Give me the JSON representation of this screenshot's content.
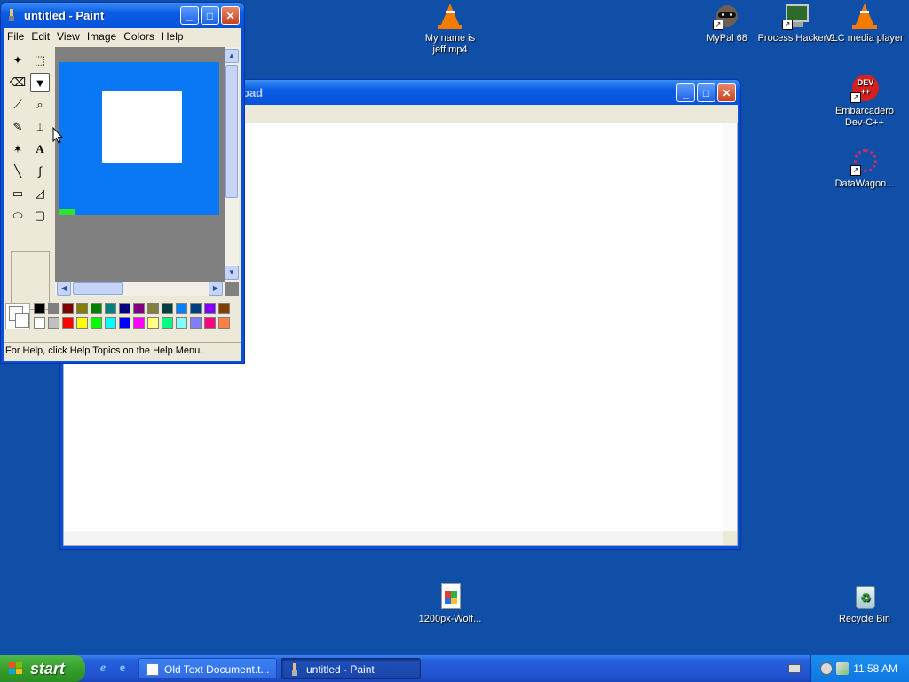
{
  "desktop": {
    "icons": [
      {
        "label": "My name is jeff.mp4",
        "icon": "vlc-cone-icon"
      },
      {
        "label": "MyPal 68",
        "icon": "raccoon-icon"
      },
      {
        "label": "Process Hacker 2",
        "icon": "monitor-icon"
      },
      {
        "label": "VLC media player",
        "icon": "vlc-cone-icon"
      },
      {
        "label": "Embarcadero Dev-C++",
        "icon": "devcpp-icon"
      },
      {
        "label": "DataWagon...",
        "icon": "network-icon"
      },
      {
        "label": "1200px-Wolf...",
        "icon": "image-file-icon"
      },
      {
        "label": "Recycle Bin",
        "icon": "recycle-bin-icon"
      }
    ],
    "shortcut_glyph": "↗"
  },
  "notepad": {
    "title_fragment": "pad",
    "buttons": {
      "minimize": "_",
      "maximize": "□",
      "close": "✕"
    }
  },
  "paint": {
    "title": "untitled - Paint",
    "menu": [
      "File",
      "Edit",
      "View",
      "Image",
      "Colors",
      "Help"
    ],
    "tools": [
      "✦",
      "⬚",
      "⌫",
      "▼",
      "⟋",
      "⌕",
      "✎",
      "⌶",
      "✶",
      "A",
      "╲",
      "∫",
      "▭",
      "◿",
      "⬭",
      "▢"
    ],
    "selected_tool": "fill-with-color",
    "canvas_bg": "#0a78f5",
    "palette_top": [
      "#000000",
      "#808080",
      "#800000",
      "#808000",
      "#008000",
      "#008080",
      "#000080",
      "#800080",
      "#808040",
      "#004040",
      "#0080ff",
      "#004080",
      "#8000ff",
      "#804000"
    ],
    "palette_bottom": [
      "#ffffff",
      "#c0c0c0",
      "#ff0000",
      "#ffff00",
      "#00ff00",
      "#00ffff",
      "#0000ff",
      "#ff00ff",
      "#ffff80",
      "#00ff80",
      "#80ffff",
      "#8080ff",
      "#ff0080",
      "#ff8040"
    ],
    "status": "For Help, click Help Topics on the Help Menu.",
    "buttons": {
      "minimize": "_",
      "maximize": "□",
      "close": "✕"
    }
  },
  "taskbar": {
    "start_label": "start",
    "quick_launch": [
      "e",
      "e"
    ],
    "tasks": [
      {
        "label": "Old Text Document.t...",
        "icon": "notepad-icon"
      },
      {
        "label": "untitled - Paint",
        "icon": "paint-icon"
      }
    ],
    "clock": "11:58 AM"
  }
}
